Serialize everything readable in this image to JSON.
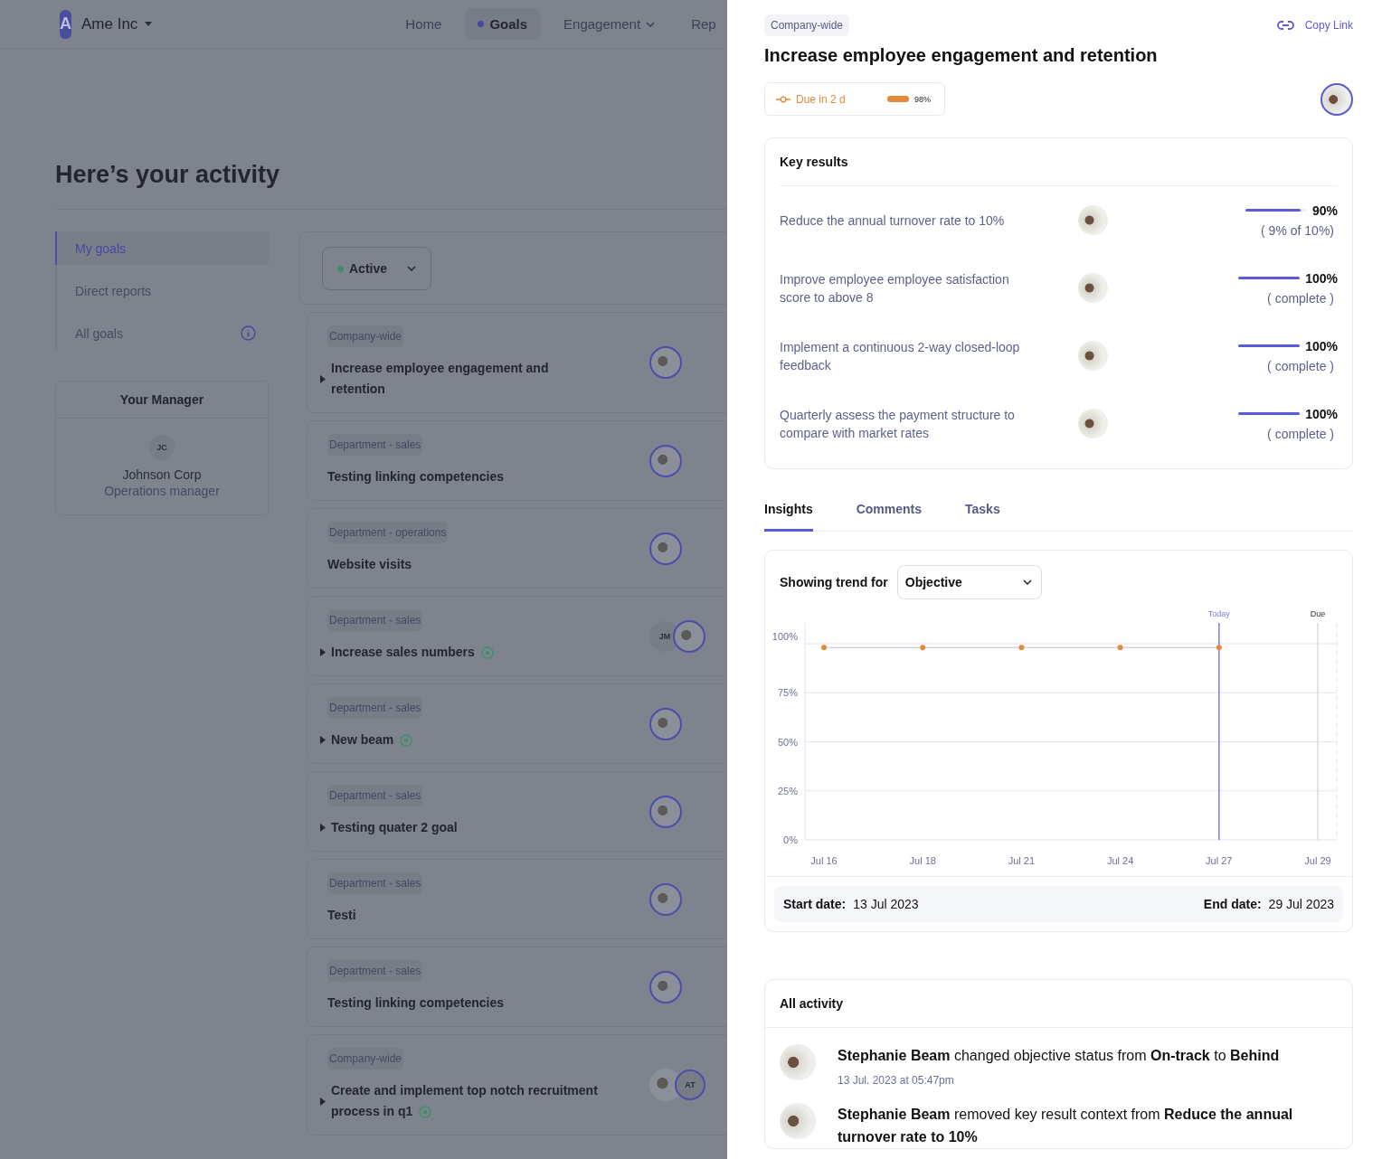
{
  "app": {
    "logo_letter": "A",
    "company": "Ame Inc"
  },
  "nav": [
    {
      "label": "Home",
      "selected": false,
      "dropdown": false
    },
    {
      "label": "Goals",
      "selected": true,
      "dropdown": false
    },
    {
      "label": "Engagement",
      "selected": false,
      "dropdown": true
    },
    {
      "label": "Rep",
      "selected": false,
      "dropdown": false
    }
  ],
  "page_title": "Here’s your activity",
  "sidebar": {
    "items": [
      {
        "label": "My goals",
        "selected": true,
        "info": false
      },
      {
        "label": "Direct reports",
        "selected": false,
        "info": false
      },
      {
        "label": "All goals",
        "selected": false,
        "info": true
      }
    ],
    "manager": {
      "heading": "Your Manager",
      "initials": "JC",
      "name": "Johnson Corp",
      "role": "Operations manager"
    }
  },
  "filter": {
    "label": "Active",
    "color": "#3d8f6a"
  },
  "goals": [
    {
      "tag": "Company-wide",
      "title": "Increase employee engagement and retention",
      "expandable": true,
      "on_track": false,
      "avatars": [
        {
          "kind": "photo"
        }
      ]
    },
    {
      "tag": "Department - sales",
      "title": "Testing linking competencies",
      "expandable": false,
      "on_track": false,
      "avatars": [
        {
          "kind": "photo"
        }
      ]
    },
    {
      "tag": "Department - operations",
      "title": "Website visits",
      "expandable": false,
      "on_track": false,
      "avatars": [
        {
          "kind": "photo"
        }
      ]
    },
    {
      "tag": "Department - sales",
      "title": "Increase sales numbers",
      "expandable": true,
      "on_track": true,
      "avatars": [
        {
          "kind": "initials",
          "text": "JM"
        },
        {
          "kind": "photo"
        }
      ]
    },
    {
      "tag": "Department - sales",
      "title": "New beam",
      "expandable": true,
      "on_track": true,
      "avatars": [
        {
          "kind": "photo"
        }
      ]
    },
    {
      "tag": "Department - sales",
      "title": "Testing quater 2 goal",
      "expandable": true,
      "on_track": false,
      "avatars": [
        {
          "kind": "photo"
        }
      ]
    },
    {
      "tag": "Department - sales",
      "title": "Testi",
      "expandable": false,
      "on_track": false,
      "avatars": [
        {
          "kind": "photo"
        }
      ]
    },
    {
      "tag": "Department - sales",
      "title": "Testing linking competencies",
      "expandable": false,
      "on_track": false,
      "avatars": [
        {
          "kind": "photo"
        }
      ]
    },
    {
      "tag": "Company-wide",
      "title": "Create and implement top notch recruitment process in q1",
      "expandable": true,
      "on_track": true,
      "avatars": [
        {
          "kind": "photo"
        },
        {
          "kind": "initials",
          "text": "AT"
        }
      ]
    }
  ],
  "detail": {
    "tag": "Company-wide",
    "copy_link": "Copy Link",
    "title": "Increase employee engagement and retention",
    "due": "Due in 2 d",
    "progress": {
      "level": 0.98,
      "reading": "98%"
    },
    "key_results": {
      "heading": "Key results",
      "items": [
        {
          "title": "Reduce the annual turnover rate to 10%",
          "level": 0.9,
          "percent": "90%",
          "note": "( 9% of 10%)"
        },
        {
          "title": "Improve employee employee satisfaction score to above 8",
          "level": 1,
          "percent": "100%",
          "note": "( complete )"
        },
        {
          "title": "Implement a continuous 2-way closed-loop feedback",
          "level": 1,
          "percent": "100%",
          "note": "( complete )"
        },
        {
          "title": "Quarterly assess the payment structure to compare with market rates",
          "level": 1,
          "percent": "100%",
          "note": "( complete )"
        }
      ]
    },
    "tabs": [
      {
        "label": "Insights",
        "selected": true
      },
      {
        "label": "Comments",
        "selected": false
      },
      {
        "label": "Tasks",
        "selected": false
      }
    ],
    "insights": {
      "trend_label": "Showing trend for",
      "chart_data": {
        "type": "line",
        "categories": [
          "Jul 16",
          "Jul 18",
          "Jul 21",
          "Jul 24",
          "Jul 27",
          "Jul 29"
        ],
        "series": [
          {
            "name": "Objective",
            "color": "#e08a3a",
            "marker": "o",
            "values": [
              98,
              98,
              98,
              98,
              98,
              null
            ]
          }
        ],
        "grid": true,
        "ylim": [
          0,
          100
        ],
        "yticks": [
          {
            "value": 0,
            "label": "0%"
          },
          {
            "value": 25,
            "label": "25%"
          },
          {
            "value": 50,
            "label": "50%"
          },
          {
            "value": 75,
            "label": "75%"
          },
          {
            "value": 100,
            "label": "100%"
          }
        ],
        "ref_lines": [
          {
            "axis": "x",
            "value": "Jul 27",
            "label": "Today",
            "color": "#7b7be0"
          },
          {
            "axis": "x",
            "value": "Jul 29",
            "label": "Due",
            "color": "#d8d8e0"
          }
        ]
      },
      "start_label": "Start date:",
      "start_value": "13 Jul 2023",
      "end_label": "End date:",
      "end_value": "29 Jul 2023"
    },
    "activity": {
      "heading": "All activity",
      "items": [
        {
          "text": "**Stephanie Beam** changed objective status from **On-track** to **Behind**",
          "time": "13 Jul. 2023 at 05:47pm"
        },
        {
          "text": "**Stephanie Beam** removed key result context from **Reduce the annual turnover rate to 10%**"
        }
      ]
    }
  }
}
